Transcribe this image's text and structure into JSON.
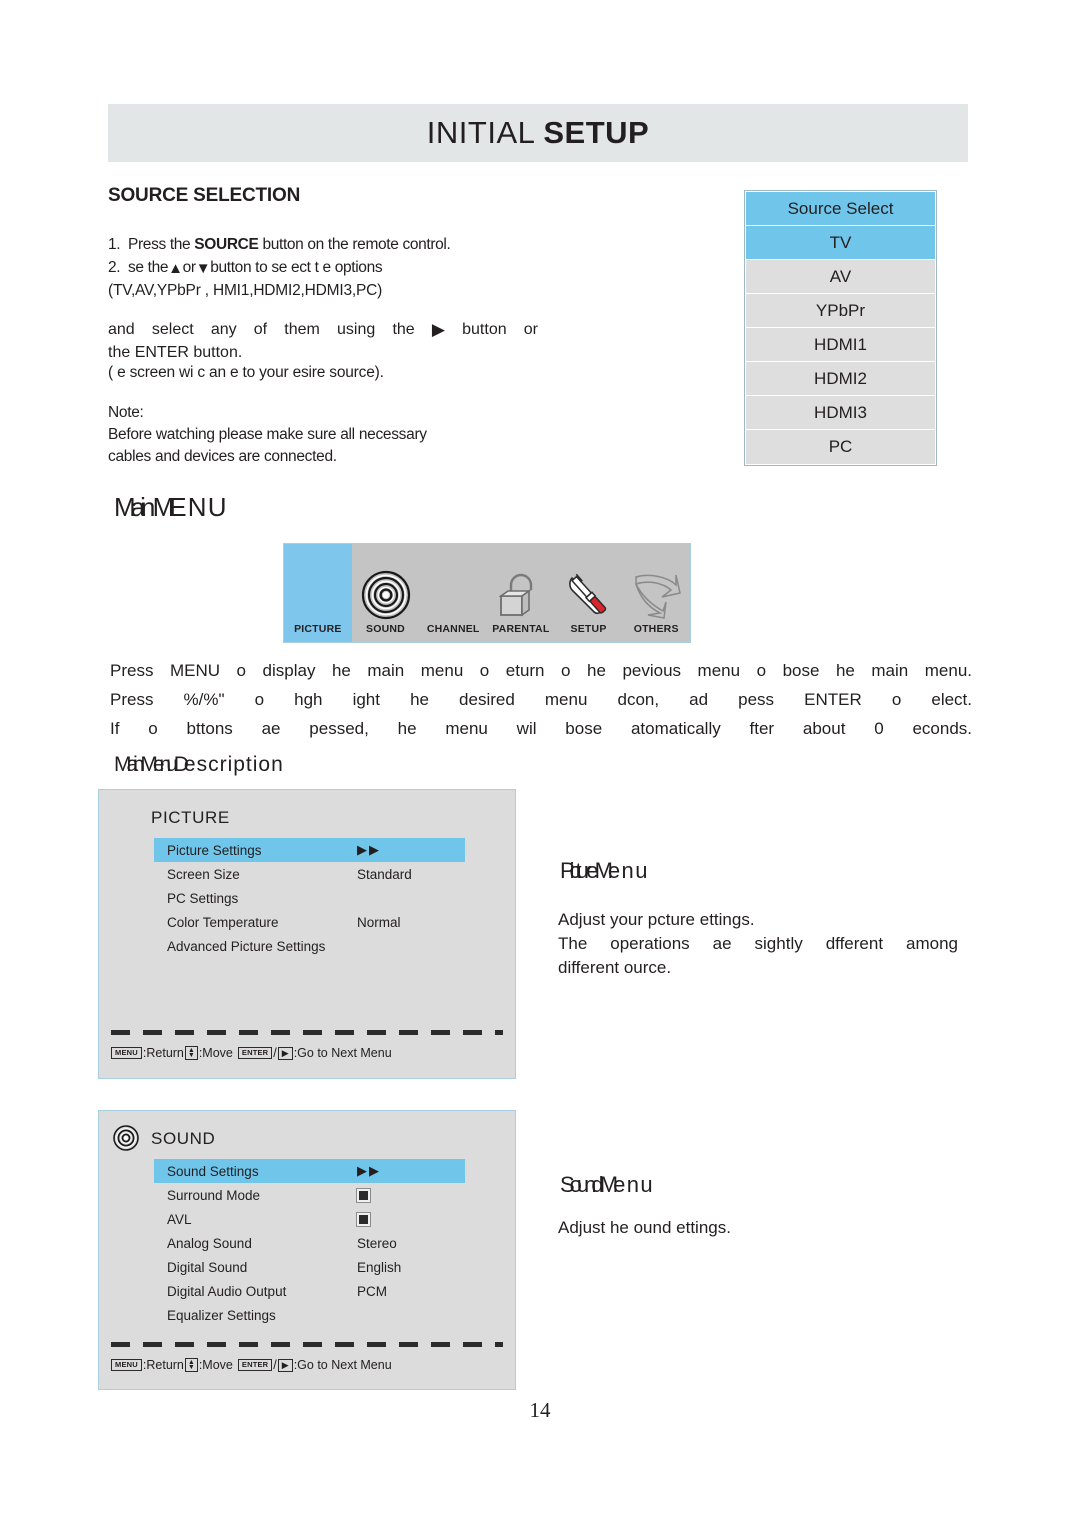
{
  "header": {
    "title_thin": "INITIAL ",
    "title_bold": "SETUP"
  },
  "source_selection": {
    "heading": "SOURCE SELECTION",
    "step1_num": "1.",
    "step1_a": "Press the ",
    "step1_b": "SOURCE",
    "step1_c": " button on the remote control.",
    "step2_num": "2.",
    "step2_a": "se the",
    "step2_up_icon": "▲",
    "step2_or": "or",
    "step2_down_icon": "▼",
    "step2_b": "button to se ect t e options",
    "sources_line": "(TV,AV,YPbPr ,  HMI1,HDMI2,HDMI3,PC)",
    "select_line1_a": "and select any of them using the",
    "select_right_icon": "▶",
    "select_line1_b": "button or",
    "select_line2": "the ENTER button.",
    "screen_line": "(  e screen wi  c an e to your  esire  source).",
    "note_label": "Note:",
    "note_line1": "Before watching please make sure all necessary",
    "note_line2": "cables and devices are connected."
  },
  "source_table": {
    "header": "Source Select",
    "rows": [
      {
        "label": "TV",
        "selected": true
      },
      {
        "label": "AV",
        "selected": false
      },
      {
        "label": "YPbPr",
        "selected": false
      },
      {
        "label": "HDMI1",
        "selected": false
      },
      {
        "label": "HDMI2",
        "selected": false
      },
      {
        "label": "HDMI3",
        "selected": false
      },
      {
        "label": "PC",
        "selected": false
      }
    ]
  },
  "main_menu": {
    "heading_a": "Main  M",
    "heading_b": "ENU",
    "items": [
      {
        "label": "PICTURE",
        "icon": "picture-icon",
        "active": true
      },
      {
        "label": "SOUND",
        "icon": "speaker-icon",
        "active": false
      },
      {
        "label": "CHANNEL",
        "icon": "channel-icon",
        "active": false
      },
      {
        "label": "PARENTAL",
        "icon": "padlock-icon",
        "active": false
      },
      {
        "label": "SETUP",
        "icon": "wrench-screwdriver-icon",
        "active": false
      },
      {
        "label": "OTHERS",
        "icon": "curved-arrow-icon",
        "active": false
      }
    ],
    "paragraph_line1": "Press  MENU  o  display  he  main  menu  o eturn  o  he  pevious  menu  o  bose  he  main  menu.",
    "paragraph_line2": "Press %/%\"  o  hgh ight  he  desired  menu  dcon,  ad  pess  ENTER  o  elect.",
    "paragraph_line3": "If  o  bttons  ae  pessed,  he  menu  wil  bose  atomatically  fter  about  0  econds."
  },
  "description": {
    "heading_a": "Main  M",
    "heading_b": "enu  D",
    "heading_c": "escription"
  },
  "picture_panel": {
    "title": "PICTURE",
    "rows": [
      {
        "label": "Picture Settings",
        "value": "▶▶",
        "type": "arrow",
        "highlight": true
      },
      {
        "label": "Screen Size",
        "value": "Standard",
        "type": "text",
        "highlight": false
      },
      {
        "label": "PC Settings",
        "value": "",
        "type": "text",
        "highlight": false
      },
      {
        "label": "Color Temperature",
        "value": "Normal",
        "type": "text",
        "highlight": false
      },
      {
        "label": "Advanced Picture Settings",
        "value": "",
        "type": "text",
        "highlight": false
      }
    ],
    "hint": {
      "menu_key": "MENU",
      "return_label": ":Return",
      "move_label": ":Move",
      "enter_key": "ENTER",
      "slash": "/",
      "right_key": "▶",
      "next_label": ":Go to Next Menu"
    }
  },
  "sound_panel": {
    "title": "SOUND",
    "rows": [
      {
        "label": "Sound Settings",
        "value": "▶▶",
        "type": "arrow",
        "highlight": true
      },
      {
        "label": "Surround Mode",
        "value": "",
        "type": "box",
        "highlight": false
      },
      {
        "label": "AVL",
        "value": "",
        "type": "box",
        "highlight": false
      },
      {
        "label": "Analog Sound",
        "value": "Stereo",
        "type": "text",
        "highlight": false
      },
      {
        "label": "Digital Sound",
        "value": "English",
        "type": "text",
        "highlight": false
      },
      {
        "label": "Digital Audio Output",
        "value": "PCM",
        "type": "text",
        "highlight": false
      },
      {
        "label": "Equalizer Settings",
        "value": "",
        "type": "text",
        "highlight": false
      }
    ],
    "hint": {
      "menu_key": "MENU",
      "return_label": ":Return",
      "move_label": ":Move",
      "enter_key": "ENTER",
      "slash": "/",
      "right_key": "▶",
      "next_label": ":Go to Next Menu"
    }
  },
  "picture_menu_section": {
    "heading_a": "Picture  M",
    "heading_b": "enu",
    "line1": "Adjust  your  pcture  ettings.",
    "line2": "The  operations  ae  sightly  dfferent  among",
    "line3": "different  ource."
  },
  "sound_menu_section": {
    "heading_a": "Sound  M",
    "heading_b": "enu",
    "line1": "Adjust  he  ound  ettings."
  },
  "footer": {
    "page_number": "14"
  },
  "colors": {
    "band": "#e2e6e7",
    "highlight_blue": "#6fc5ea",
    "menu_bar_gray": "#c4c4c4",
    "osd_gray": "#dcdcdc",
    "row_gray": "#dedede",
    "border_blue": "#a9cfe0",
    "text": "#231f20",
    "screwdriver_red": "#d8262c"
  }
}
